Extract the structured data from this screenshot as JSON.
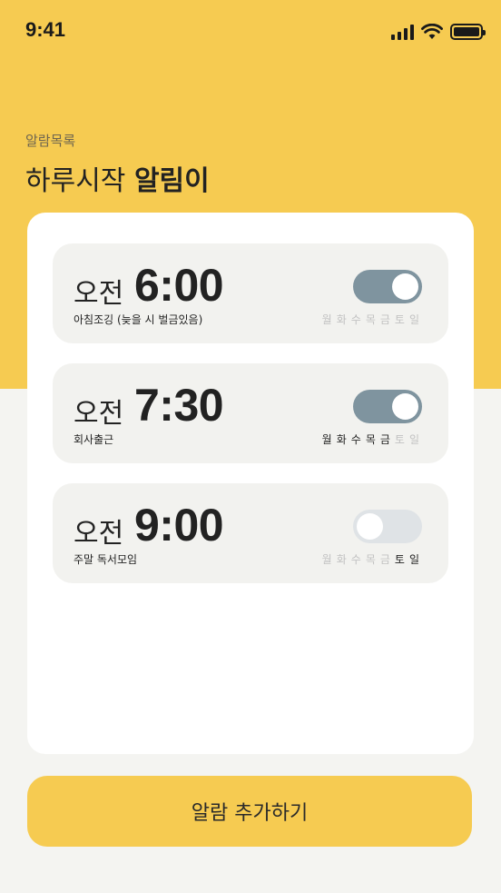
{
  "status": {
    "time": "9:41"
  },
  "header": {
    "subtitle": "알람목록",
    "title_regular": "하루시작",
    "title_bold": "알림이"
  },
  "alarms": [
    {
      "ampm": "오전",
      "time": "6:00",
      "label": "아침조깅 (늦을 시 벌금있음)",
      "enabled": true,
      "days": [
        {
          "d": "월",
          "active": false
        },
        {
          "d": "화",
          "active": false
        },
        {
          "d": "수",
          "active": false
        },
        {
          "d": "목",
          "active": false
        },
        {
          "d": "금",
          "active": false
        },
        {
          "d": "토",
          "active": false
        },
        {
          "d": "일",
          "active": false
        }
      ]
    },
    {
      "ampm": "오전",
      "time": "7:30",
      "label": "회사출근",
      "enabled": true,
      "days": [
        {
          "d": "월",
          "active": true
        },
        {
          "d": "화",
          "active": true
        },
        {
          "d": "수",
          "active": true
        },
        {
          "d": "목",
          "active": true
        },
        {
          "d": "금",
          "active": true
        },
        {
          "d": "토",
          "active": false
        },
        {
          "d": "일",
          "active": false
        }
      ]
    },
    {
      "ampm": "오전",
      "time": "9:00",
      "label": "주말 독서모임",
      "enabled": false,
      "days": [
        {
          "d": "월",
          "active": false
        },
        {
          "d": "화",
          "active": false
        },
        {
          "d": "수",
          "active": false
        },
        {
          "d": "목",
          "active": false
        },
        {
          "d": "금",
          "active": false
        },
        {
          "d": "토",
          "active": true
        },
        {
          "d": "일",
          "active": true
        }
      ]
    }
  ],
  "add_button": {
    "label": "알람 추가하기"
  },
  "colors": {
    "accent": "#f6cb51",
    "toggle_on": "#7f949f",
    "toggle_off": "#dfe3e6",
    "day_inactive": "#c2c2c2"
  }
}
